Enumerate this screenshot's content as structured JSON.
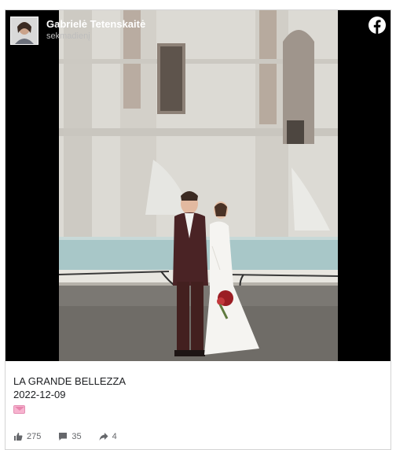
{
  "post": {
    "author": "Gabrielė Tetenskaitė",
    "date": "sekmadienį",
    "caption_line1": "LA GRANDE BELLEZZA",
    "caption_line2": "2022-12-09",
    "emoji": "envelope-heart-emoji",
    "brand_icon": "facebook-icon",
    "brand_color": "#ffffff"
  },
  "stats": {
    "likes": "275",
    "comments": "35",
    "shares": "4"
  }
}
